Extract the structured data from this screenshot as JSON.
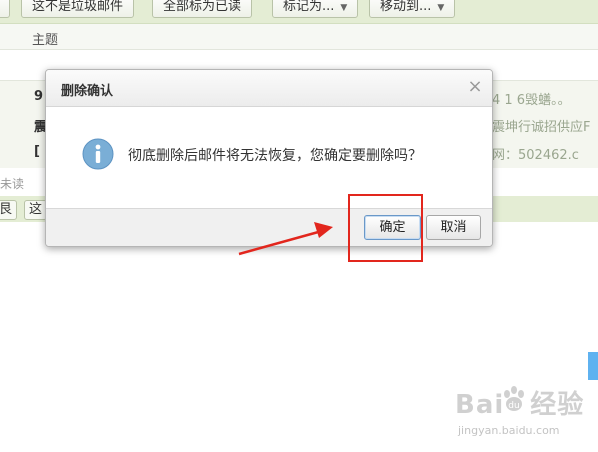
{
  "toolbar": {
    "buttons": [
      {
        "label": "这不是垃圾邮件",
        "has_dropdown": false
      },
      {
        "label": "全部标为已读",
        "has_dropdown": false
      },
      {
        "label": "标记为...",
        "has_dropdown": true
      },
      {
        "label": "移动到...",
        "has_dropdown": true
      }
    ],
    "dropdown_glyph": "▼"
  },
  "column_header": {
    "subject_label": "主题"
  },
  "mail_list": {
    "rows": [
      {
        "prefix": "9",
        "tail": "4 1 6毁蟮。。"
      },
      {
        "prefix": "震",
        "tail": "震坤行诚招供应F"
      },
      {
        "prefix": "[",
        "tail": "网：502462.c"
      }
    ],
    "unread_label": "未读",
    "bottom_buttons": [
      "艮",
      "这"
    ]
  },
  "dialog": {
    "title": "删除确认",
    "close_glyph": "×",
    "icon": "info-icon",
    "message": "彻底删除后邮件将无法恢复，您确定要删除吗？",
    "ok_label": "确定",
    "cancel_label": "取消"
  },
  "watermark": {
    "logo_left": "Bai",
    "logo_right": "经验",
    "subtitle": "jingyan.baidu.com"
  },
  "colors": {
    "toolbar_bg": "#e4edd4",
    "annotation_red": "#e2261d",
    "info_blue": "#7aaed6"
  }
}
